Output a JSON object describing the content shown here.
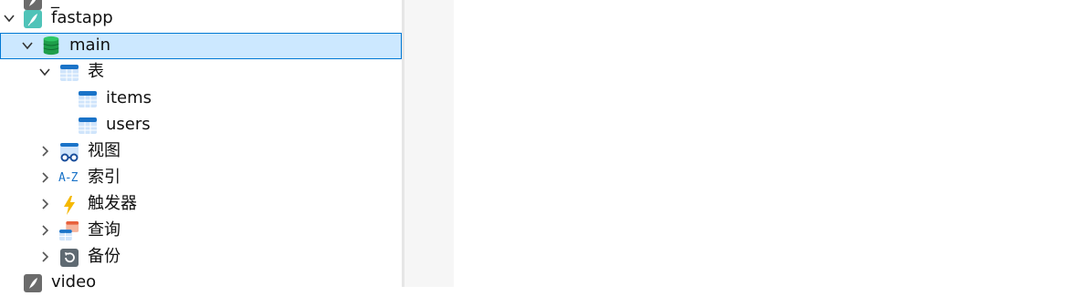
{
  "tree": {
    "items": [
      {
        "label": "_"
      },
      {
        "label": "fastapp"
      },
      {
        "label": "main"
      },
      {
        "label": "表"
      },
      {
        "label": "items"
      },
      {
        "label": "users"
      },
      {
        "label": "视图"
      },
      {
        "label": "索引"
      },
      {
        "label": "触发器"
      },
      {
        "label": "查询"
      },
      {
        "label": "备份"
      },
      {
        "label": "video"
      }
    ]
  },
  "icons": {
    "index_text": "A-Z"
  },
  "colors": {
    "selection_bg": "#cce8ff",
    "selection_border": "#0078d4",
    "db_green": "#1e9e4a",
    "table_blue": "#1a73c8",
    "trigger_yellow": "#f5b800"
  }
}
